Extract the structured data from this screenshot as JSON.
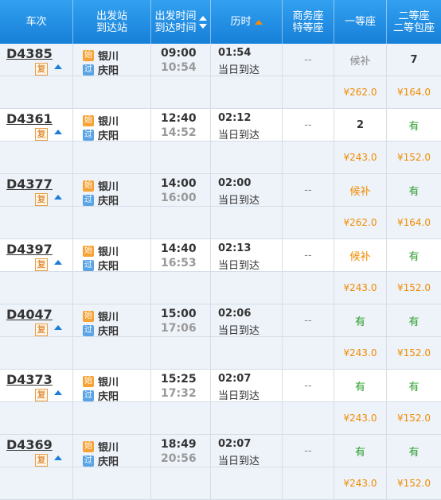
{
  "header": {
    "train_no": "车次",
    "station_line1": "出发站",
    "station_line2": "到达站",
    "time_line1": "出发时间",
    "time_line2": "到达时间",
    "duration": "历时",
    "business_line1": "商务座",
    "business_line2": "特等座",
    "first_class": "一等座",
    "second_line1": "二等座",
    "second_line2": "二等包座"
  },
  "badges": {
    "start": "始",
    "pass": "过",
    "fu": "复"
  },
  "trains": [
    {
      "no": "D4385",
      "from": "银川",
      "to": "庆阳",
      "dep": "09:00",
      "arr": "10:54",
      "dur": "01:54",
      "day": "当日到达",
      "business": "--",
      "first": "候补",
      "second": "7",
      "first_price": "¥262.0",
      "second_price": "¥164.0"
    },
    {
      "no": "D4361",
      "from": "银川",
      "to": "庆阳",
      "dep": "12:40",
      "arr": "14:52",
      "dur": "02:12",
      "day": "当日到达",
      "business": "--",
      "first": "2",
      "second": "有",
      "first_price": "¥243.0",
      "second_price": "¥152.0"
    },
    {
      "no": "D4377",
      "from": "银川",
      "to": "庆阳",
      "dep": "14:00",
      "arr": "16:00",
      "dur": "02:00",
      "day": "当日到达",
      "business": "--",
      "first": "候补",
      "second": "有",
      "first_price": "¥262.0",
      "second_price": "¥164.0"
    },
    {
      "no": "D4397",
      "from": "银川",
      "to": "庆阳",
      "dep": "14:40",
      "arr": "16:53",
      "dur": "02:13",
      "day": "当日到达",
      "business": "--",
      "first": "候补",
      "second": "有",
      "first_price": "¥243.0",
      "second_price": "¥152.0"
    },
    {
      "no": "D4047",
      "from": "银川",
      "to": "庆阳",
      "dep": "15:00",
      "arr": "17:06",
      "dur": "02:06",
      "day": "当日到达",
      "business": "--",
      "first": "有",
      "second": "有",
      "first_price": "¥243.0",
      "second_price": "¥152.0"
    },
    {
      "no": "D4373",
      "from": "银川",
      "to": "庆阳",
      "dep": "15:25",
      "arr": "17:32",
      "dur": "02:07",
      "day": "当日到达",
      "business": "--",
      "first": "有",
      "second": "有",
      "first_price": "¥243.0",
      "second_price": "¥152.0"
    },
    {
      "no": "D4369",
      "from": "银川",
      "to": "庆阳",
      "dep": "18:49",
      "arr": "20:56",
      "dur": "02:07",
      "day": "当日到达",
      "business": "--",
      "first": "有",
      "second": "有",
      "first_price": "¥243.0",
      "second_price": "¥152.0"
    }
  ],
  "colors": {
    "header": "#1f8ee6",
    "price": "#f08c00",
    "available": "#2a9d2a",
    "row_alt": "#eef3fa"
  }
}
